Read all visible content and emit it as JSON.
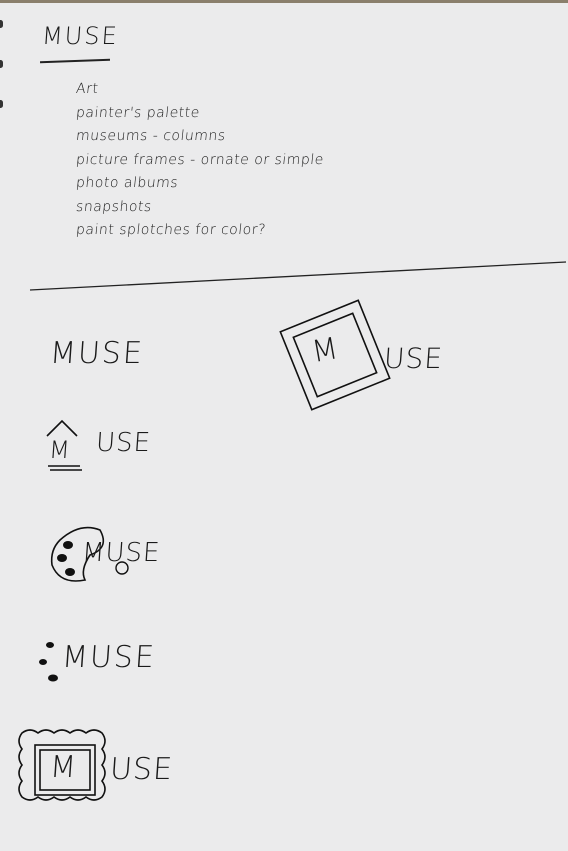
{
  "notes": {
    "title": "MUSE",
    "ideas": [
      "Art",
      "painter's palette",
      "museums - columns",
      "picture frames - ornate or simple",
      "photo albums",
      "snapshots",
      "paint splotches for color?"
    ]
  },
  "logo_sketches": {
    "plain": "MUSE",
    "tilted_frame": {
      "letter": "M",
      "rest": "USE"
    },
    "museum_roof": {
      "letter": "M",
      "rest": "USE"
    },
    "palette": "MUSE",
    "paint_dots": "MUSE",
    "ornate_frame": {
      "letter": "M",
      "rest": "USE"
    }
  },
  "colors": {
    "paper": "#ebebec",
    "ink": "#1a1a1a"
  }
}
